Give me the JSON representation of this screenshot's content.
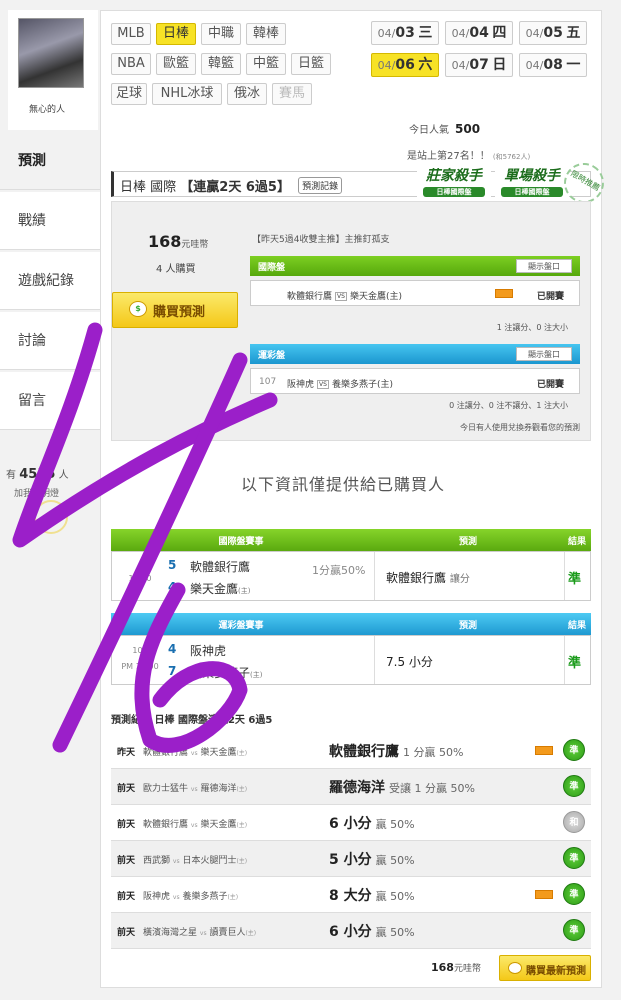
{
  "profile": {
    "name": "無心的人"
  },
  "sidebar": {
    "items": [
      {
        "label": "預測"
      },
      {
        "label": "戰績"
      },
      {
        "label": "遊戲紀錄"
      },
      {
        "label": "討論"
      },
      {
        "label": "留言"
      }
    ],
    "popularity_prefix": "有",
    "popularity_value": "4535",
    "popularity_suffix": "人",
    "friend_link": "加我為明燈"
  },
  "league_tabs": [
    "MLB",
    "日棒",
    "中職",
    "韓棒",
    "NBA",
    "歐籃",
    "韓籃",
    "中籃",
    "日籃",
    "足球",
    "NHL冰球",
    "俄冰",
    "賽馬"
  ],
  "selected_league": "日棒",
  "dates": [
    {
      "md": "04/",
      "day": "03",
      "wd": "三"
    },
    {
      "md": "04/",
      "day": "04",
      "wd": "四"
    },
    {
      "md": "04/",
      "day": "05",
      "wd": "五"
    },
    {
      "md": "04/",
      "day": "06",
      "wd": "六"
    },
    {
      "md": "04/",
      "day": "07",
      "wd": "日"
    },
    {
      "md": "04/",
      "day": "08",
      "wd": "一"
    }
  ],
  "stats": {
    "today_label": "今日人氣",
    "today_value": "500",
    "rank_label": "是站上第27名！！",
    "rank_small": "(和5762人)"
  },
  "prediction": {
    "league": "日棒 國際",
    "streak": "【連贏2天 6過5】",
    "record_btn": "預測記錄",
    "badge1_title": "莊家殺手",
    "badge1_sub": "日棒國際盤",
    "badge2_title": "單場殺手",
    "badge2_sub": "日棒國際盤",
    "limit_badge": "限時推薦",
    "price": "168",
    "price_unit": "元哇幣",
    "buyers": "4 人購買",
    "buy_label": "購買預測",
    "desc": "【昨天5過4收雙主推】主推釘孤支",
    "intl_header": "國際盤",
    "intl_show": "顯示盤口",
    "intl_home": "軟體銀行鷹",
    "intl_away": "樂天金鷹(主)",
    "intl_status": "已開賽",
    "intl_tally": "1 注讓分、0 注大小",
    "lottery_header": "運彩盤",
    "lottery_show": "顯示盤口",
    "lottery_code": "107",
    "lottery_home": "阪神虎",
    "lottery_away": "養樂多燕子(主)",
    "lottery_status": "已開賽",
    "lottery_tally": "0 注讓分、0 注不讓分、1 注大小",
    "exchange_note": "今日有人使用兌換券觀看您的預測",
    "vs": "VS"
  },
  "notice": "以下資訊僅提供給已購買人",
  "table1": {
    "headers": [
      "國際盤賽事",
      "預測",
      "結果"
    ],
    "time": "13:00",
    "n1": "5",
    "team1": "軟體銀行鷹",
    "n2": "4",
    "team2": "樂天金鷹",
    "team2_tag": "(主)",
    "handicap": "1分贏50%",
    "pick": "軟體銀行鷹",
    "pick_tag": "讓分",
    "result": "準"
  },
  "table2": {
    "headers": [
      "運彩盤賽事",
      "預測",
      "結果"
    ],
    "code": "107",
    "time": "PM 13:00",
    "n1": "4",
    "team1": "阪神虎",
    "n2": "7",
    "team2": "養樂多燕子",
    "team2_tag": "(主)",
    "pick": "7.5 小分",
    "result": "準"
  },
  "history": {
    "title": "預測紀錄 日棒 國際盤連贏2天 6過5",
    "rows": [
      {
        "day": "昨天",
        "home": "軟體銀行鷹",
        "away": "樂天金鷹",
        "away_tag": "(主)",
        "pick": "軟體銀行鷹",
        "detail": "1 分贏 50%",
        "live": true,
        "result": "準"
      },
      {
        "day": "前天",
        "home": "歐力士猛牛",
        "away": "羅德海洋",
        "away_tag": "(主)",
        "pick": "羅德海洋",
        "detail": "受讓 1 分贏 50%",
        "live": false,
        "result": "準"
      },
      {
        "day": "前天",
        "home": "軟體銀行鷹",
        "away": "樂天金鷹",
        "away_tag": "(主)",
        "pick": "6 小分",
        "detail": "贏 50%",
        "live": false,
        "result": "和"
      },
      {
        "day": "前天",
        "home": "西武獅",
        "away": "日本火腿鬥士",
        "away_tag": "(主)",
        "pick": "5 小分",
        "detail": "贏 50%",
        "live": false,
        "result": "準"
      },
      {
        "day": "前天",
        "home": "阪神虎",
        "away": "養樂多燕子",
        "away_tag": "(主)",
        "pick": "8 大分",
        "detail": "贏 50%",
        "live": true,
        "result": "準"
      },
      {
        "day": "前天",
        "home": "橫濱海灣之星",
        "away": "讀賣巨人",
        "away_tag": "(主)",
        "pick": "6 小分",
        "detail": "贏 50%",
        "live": false,
        "result": "準"
      }
    ],
    "vs": "vs"
  },
  "footer": {
    "price": "168",
    "price_unit": "元哇幣",
    "buy_label": "購買最新預測"
  },
  "colors": {
    "accent_yellow": "#f7e226",
    "green": "#56a80c",
    "blue": "#1b96cf",
    "scrawl": "#9b1fc9"
  }
}
